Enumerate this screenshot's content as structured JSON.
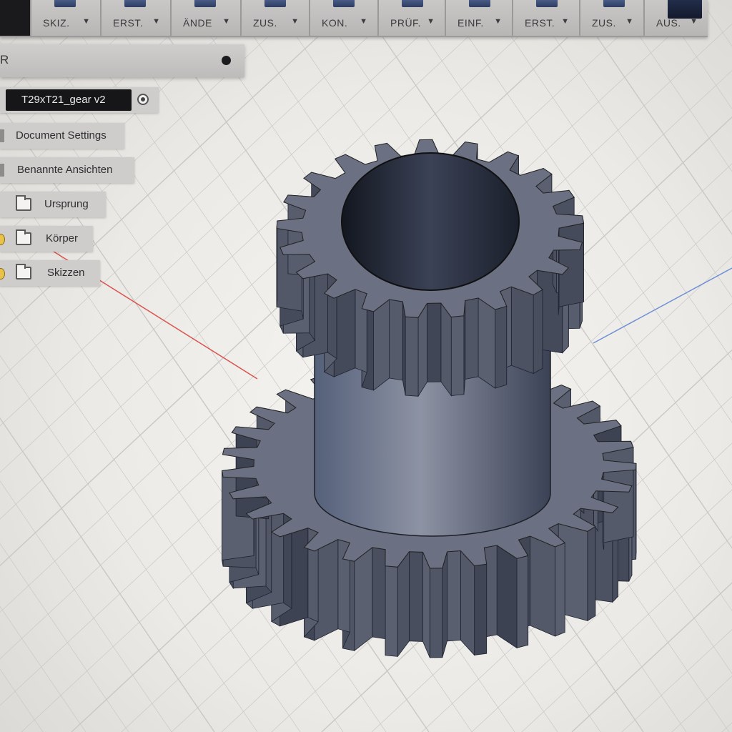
{
  "toolbar": {
    "groups": [
      {
        "label": "SKIZ.",
        "icon": "sketch-icon"
      },
      {
        "label": "ERST.",
        "icon": "create-icon"
      },
      {
        "label": "ÄNDE",
        "icon": "modify-icon"
      },
      {
        "label": "ZUS.",
        "icon": "assemble-icon"
      },
      {
        "label": "KON.",
        "icon": "construct-icon"
      },
      {
        "label": "PRÜF.",
        "icon": "inspect-icon"
      },
      {
        "label": "EINF.",
        "icon": "insert-icon"
      },
      {
        "label": "ERST.",
        "icon": "make-icon"
      },
      {
        "label": "ZUS.",
        "icon": "addins-icon"
      },
      {
        "label": "AUS.",
        "icon": "select-icon"
      }
    ],
    "caret": "▼"
  },
  "browser": {
    "header": "R",
    "root": "T29xT21_gear v2",
    "items": [
      {
        "label": "Document Settings"
      },
      {
        "label": "Benannte Ansichten"
      },
      {
        "label": "Ursprung"
      },
      {
        "label": "Körper"
      },
      {
        "label": "Skizzen"
      }
    ]
  },
  "viewport": {
    "model": "spur-gear-pair",
    "top_gear_teeth": 21,
    "bottom_gear_teeth": 29,
    "colors": {
      "gear_body": "#5e6474",
      "gear_top_face": "#6b7082",
      "bore": "#2a3040",
      "grid_line": "#c9c8c6",
      "x_axis": "#d9534f",
      "z_axis": "#6f8fd6"
    }
  }
}
